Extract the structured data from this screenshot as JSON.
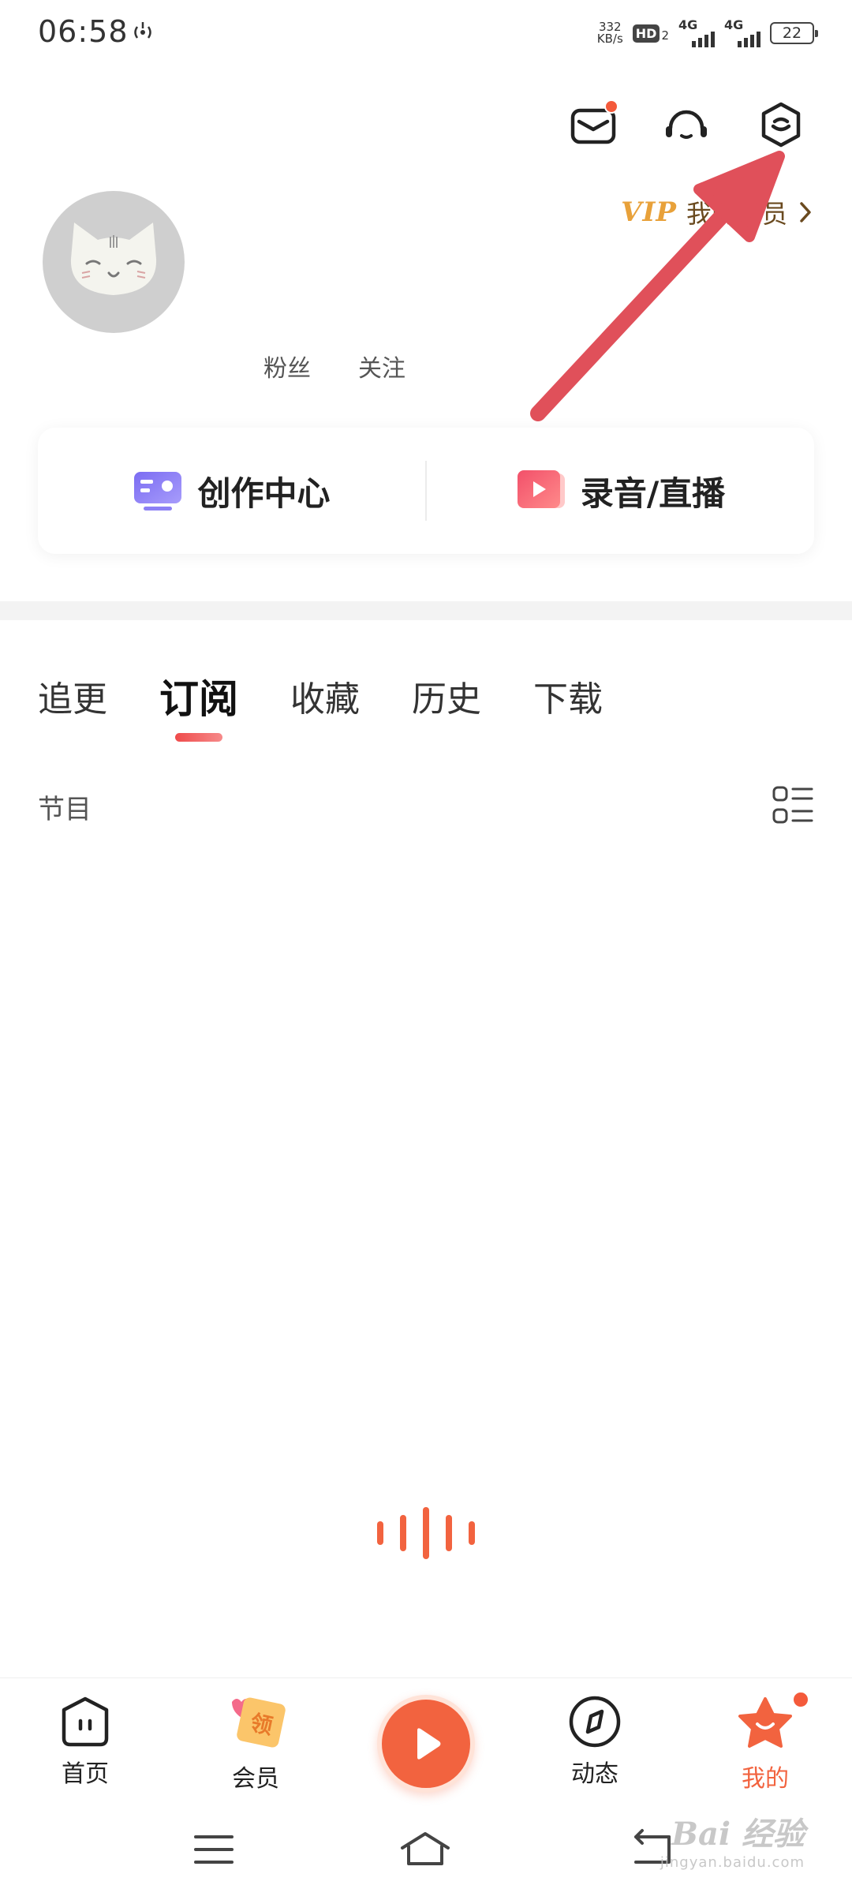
{
  "status_bar": {
    "time": "06:58",
    "net_speed_value": "332",
    "net_speed_unit": "KB/s",
    "hd_label": "HD",
    "hd_sub": "2",
    "signal1_label": "4G",
    "signal2_label": "4G",
    "battery_level": "22"
  },
  "header": {
    "mail_icon": "mail-icon",
    "support_icon": "headset-icon",
    "settings_icon": "settings-icon",
    "mail_has_badge": true
  },
  "profile": {
    "vip_logo": "VIP",
    "vip_text": "我的会员",
    "fans_label": "粉丝",
    "follow_label": "关注"
  },
  "actions": {
    "creation_center": "创作中心",
    "record_live": "录音/直播"
  },
  "tabs": [
    {
      "label": "追更"
    },
    {
      "label": "订阅"
    },
    {
      "label": "收藏"
    },
    {
      "label": "历史"
    },
    {
      "label": "下载"
    }
  ],
  "active_tab": "订阅",
  "content": {
    "section_label": "节目"
  },
  "bottom_nav": {
    "items": [
      {
        "label": "首页",
        "icon": "home-icon"
      },
      {
        "label": "会员",
        "icon": "vip-coupon-icon",
        "badge_text": "领"
      },
      {
        "label": "动态",
        "icon": "compass-icon"
      },
      {
        "label": "我的",
        "icon": "star-profile-icon"
      }
    ],
    "active": "我的"
  },
  "watermark": {
    "main": "Bai 经验",
    "sub": "jingyan.baidu.com"
  },
  "colors": {
    "accent": "#f2633f",
    "vip_gold": "#e8a13a",
    "badge_red": "#f45a3b",
    "annotation_arrow": "#e0505a"
  }
}
